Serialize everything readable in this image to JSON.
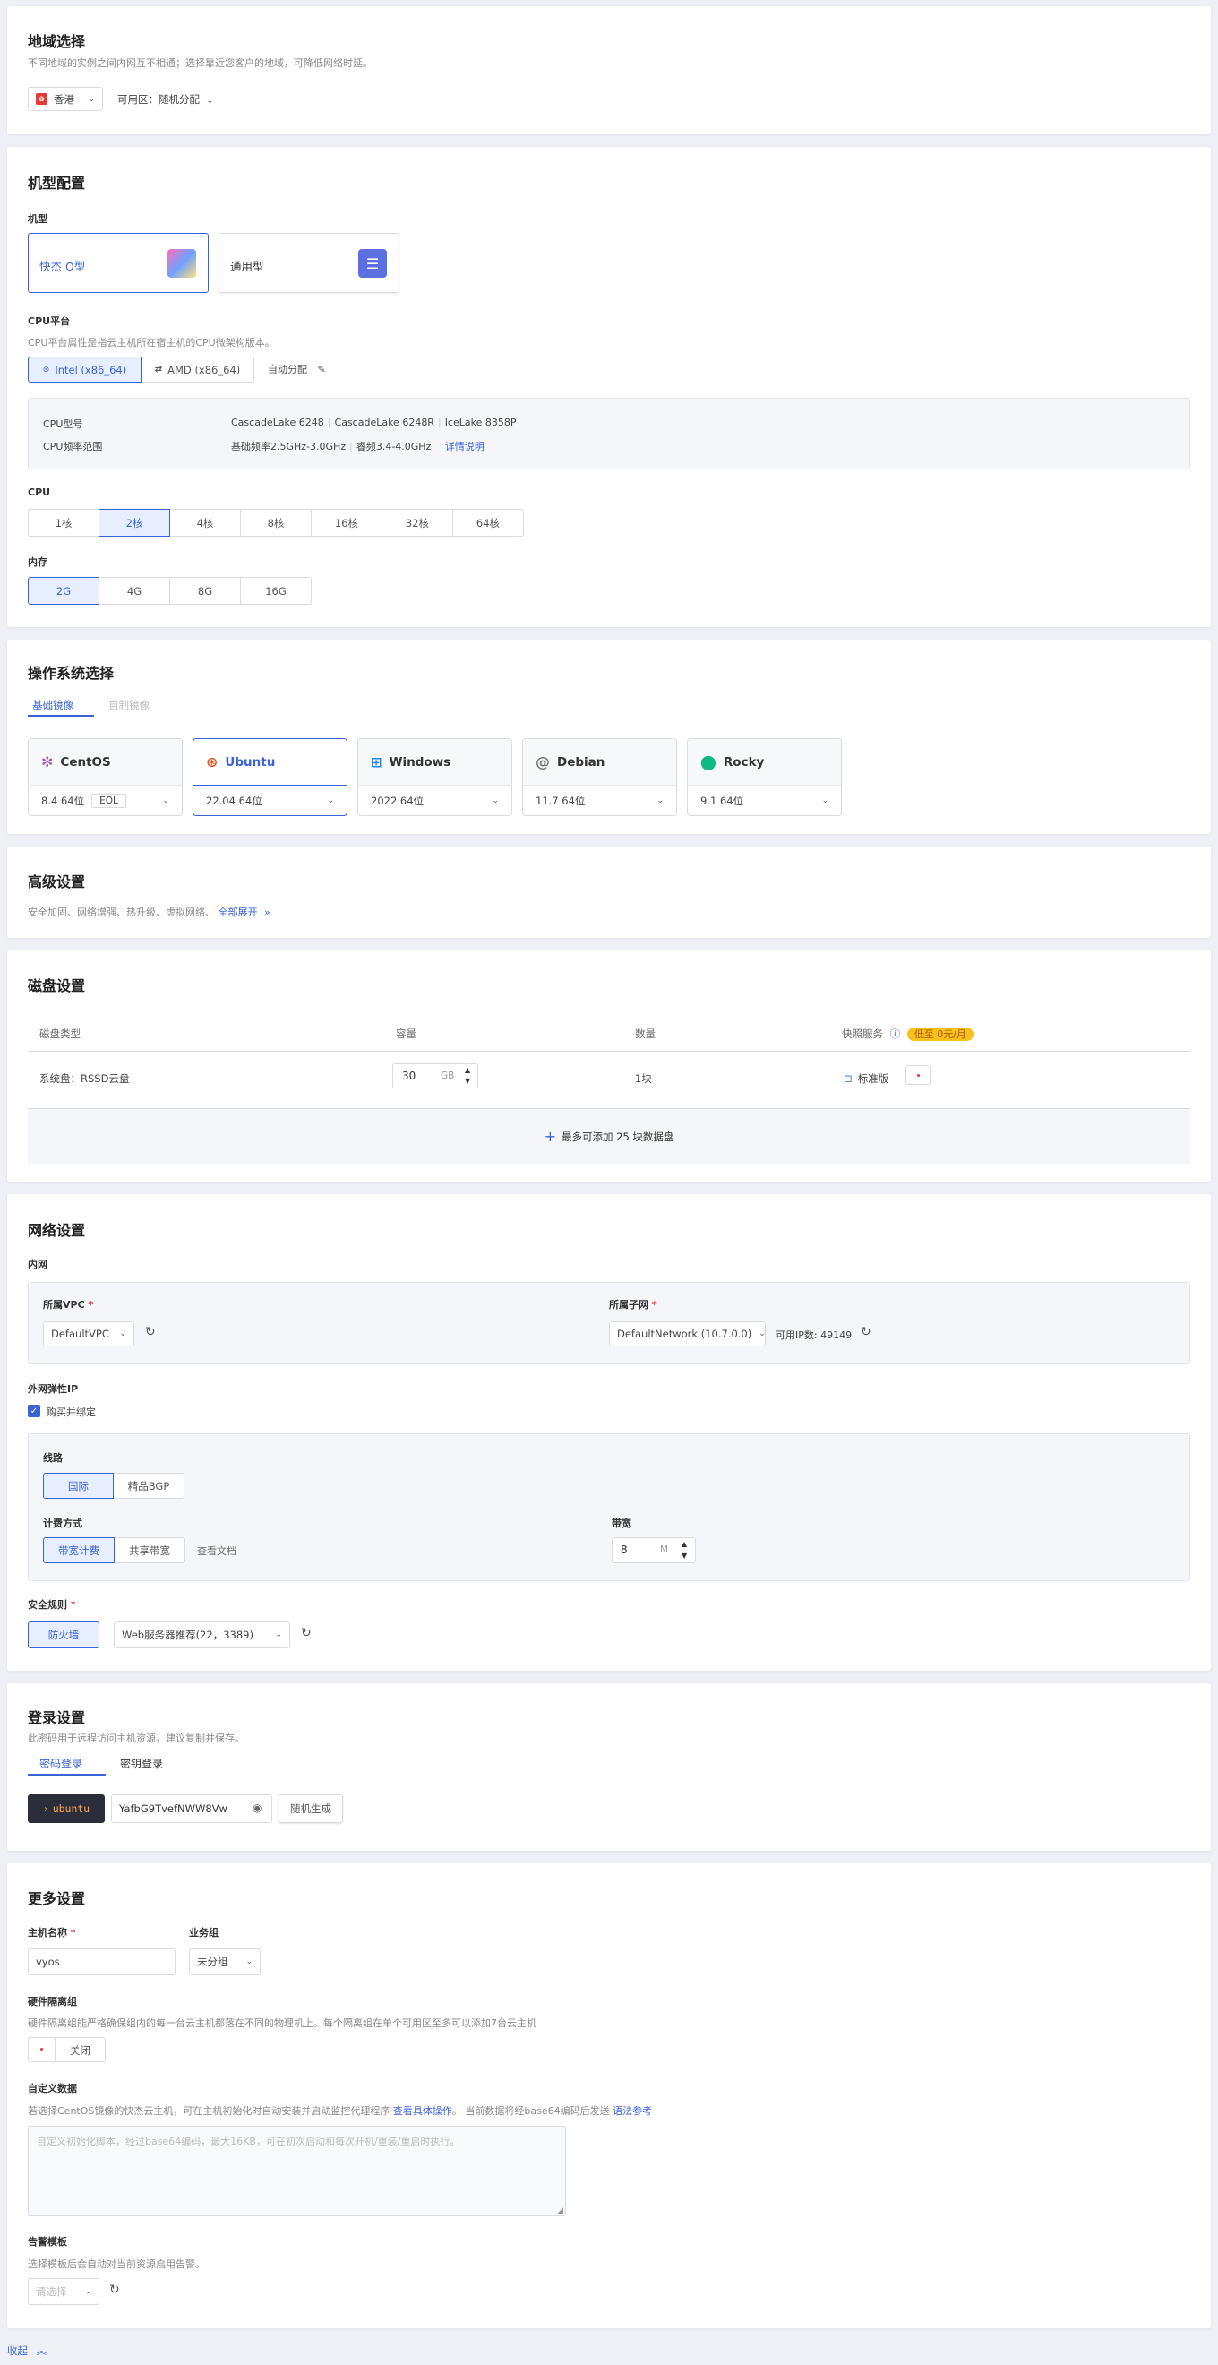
{
  "colors": {
    "accent": "#3a63d8",
    "badge": "#f6c11c",
    "required": "#e33333",
    "terminal_bg": "#2b2d3a",
    "terminal_text": "#ffa94d"
  },
  "region": {
    "title": "地域选择",
    "desc": "不同地域的实例之间内网互不相通；选择靠近您客户的地域，可降低网络时延。",
    "region_value": "香港",
    "zone_label": "可用区：随机分配"
  },
  "machine": {
    "title": "机型配置",
    "type_label": "机型",
    "types": [
      "快杰 O型",
      "通用型"
    ],
    "cpu_platform_label": "CPU平台",
    "cpu_platform_desc": "CPU平台属性是指云主机所在宿主机的CPU微架构版本。",
    "platforms": [
      "Intel (x86_64)",
      "AMD (x86_64)"
    ],
    "auto_assign": "自动分配",
    "cpu_model_label": "CPU型号",
    "cpu_models": [
      "CascadeLake 6248",
      "CascadeLake 6248R",
      "IceLake 8358P"
    ],
    "cpu_freq_label": "CPU频率范围",
    "cpu_freq_base": "基础频率2.5GHz-3.0GHz",
    "cpu_freq_turbo": "睿频3.4-4.0GHz",
    "detail_link": "详情说明",
    "cpu_label": "CPU",
    "cpu_options": [
      "1核",
      "2核",
      "4核",
      "8核",
      "16核",
      "32核",
      "64核"
    ],
    "cpu_selected": "2核",
    "mem_label": "内存",
    "mem_options": [
      "2G",
      "4G",
      "8G",
      "16G"
    ],
    "mem_selected": "2G"
  },
  "os": {
    "title": "操作系统选择",
    "tabs": [
      "基础镜像",
      "自制镜像"
    ],
    "cards": [
      {
        "name": "CentOS",
        "version": "8.4 64位",
        "tag": "EOL",
        "icon": "centos-icon"
      },
      {
        "name": "Ubuntu",
        "version": "22.04 64位",
        "tag": "",
        "icon": "ubuntu-icon"
      },
      {
        "name": "Windows",
        "version": "2022 64位",
        "tag": "",
        "icon": "windows-icon"
      },
      {
        "name": "Debian",
        "version": "11.7 64位",
        "tag": "",
        "icon": "debian-icon"
      },
      {
        "name": "Rocky",
        "version": "9.1 64位",
        "tag": "",
        "icon": "rocky-icon"
      }
    ],
    "selected": "Ubuntu"
  },
  "advanced": {
    "title": "高级设置",
    "desc": "安全加固、网络增强、热升级、虚拟网络、",
    "expand": "全部展开"
  },
  "disk": {
    "title": "磁盘设置",
    "headers": [
      "磁盘类型",
      "容量",
      "数量",
      "快照服务"
    ],
    "badge": "低至 0元/月",
    "row_type": "系统盘：RSSD云盘",
    "capacity": "30",
    "unit": "GB",
    "count": "1块",
    "snapshot": "标准版",
    "add_text": "最多可添加 25 块数据盘"
  },
  "network": {
    "title": "网络设置",
    "intranet_label": "内网",
    "vpc_label": "所属VPC",
    "vpc_value": "DefaultVPC",
    "subnet_label": "所属子网",
    "subnet_value": "DefaultNetwork (10.7.0.0)",
    "ip_available": "可用IP数: 49149",
    "eip_label": "外网弹性IP",
    "eip_checkbox": "购买并绑定",
    "line_label": "线路",
    "lines": [
      "国际",
      "精品BGP"
    ],
    "billing_label": "计费方式",
    "billing_options": [
      "带宽计费",
      "共享带宽"
    ],
    "doc_link": "查看文档",
    "bandwidth_label": "带宽",
    "bandwidth_value": "8",
    "bandwidth_unit": "M",
    "security_label": "安全规则",
    "firewall": "防火墙",
    "firewall_rule": "Web服务器推荐(22，3389)"
  },
  "login": {
    "title": "登录设置",
    "desc": "此密码用于远程访问主机资源，建议复制并保存。",
    "tabs": [
      "密码登录",
      "密钥登录"
    ],
    "user": "ubuntu",
    "password": "YafbG9TvefNWW8Vw",
    "generate": "随机生成"
  },
  "more": {
    "title": "更多设置",
    "hostname_label": "主机名称",
    "hostname_value": "vyos",
    "group_label": "业务组",
    "group_value": "未分组",
    "isolation_label": "硬件隔离组",
    "isolation_desc": "硬件隔离组能严格确保组内的每一台云主机都落在不同的物理机上。每个隔离组在单个可用区至多可以添加7台云主机",
    "isolation_state": "关闭",
    "userdata_label": "自定义数据",
    "userdata_desc": "若选择CentOS镜像的快杰云主机，可在主机初始化时自动安装并启动监控代理程序",
    "userdata_link": "查看具体操作",
    "userdata_desc2": "。 当前数据将经base64编码后发送",
    "userdata_link2": "语法参考",
    "userdata_placeholder": "自定义初始化脚本，经过base64编码，最大16KB，可在初次启动和每次开机/重装/重启时执行。",
    "alert_label": "告警模板",
    "alert_desc": "选择模板后会自动对当前资源启用告警。",
    "alert_placeholder": "请选择"
  },
  "footer": {
    "collapse": "收起"
  }
}
